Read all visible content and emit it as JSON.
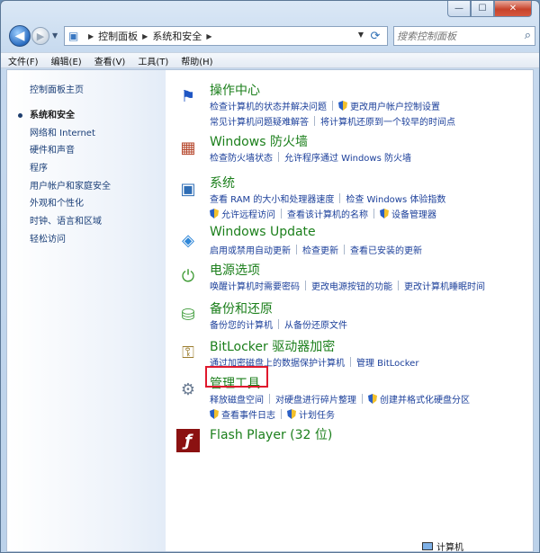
{
  "window": {
    "caption": {
      "minimize": "—",
      "maximize": "☐",
      "close": "✕"
    }
  },
  "address": {
    "crumbs": [
      "控制面板",
      "系统和安全"
    ],
    "search_placeholder": "搜索控制面板"
  },
  "menu": [
    "文件(F)",
    "编辑(E)",
    "查看(V)",
    "工具(T)",
    "帮助(H)"
  ],
  "sidebar": {
    "home": "控制面板主页",
    "items": [
      {
        "label": "系统和安全",
        "current": true
      },
      {
        "label": "网络和 Internet"
      },
      {
        "label": "硬件和声音"
      },
      {
        "label": "程序"
      },
      {
        "label": "用户帐户和家庭安全"
      },
      {
        "label": "外观和个性化"
      },
      {
        "label": "时钟、语言和区域"
      },
      {
        "label": "轻松访问"
      }
    ]
  },
  "categories": [
    {
      "title": "操作中心",
      "icon": "flag-icon",
      "lines": [
        [
          {
            "text": "检查计算机的状态并解决问题"
          },
          {
            "text": "更改用户帐户控制设置",
            "shield": true
          }
        ],
        [
          {
            "text": "常见计算机问题疑难解答"
          },
          {
            "text": "将计算机还原到一个较早的时间点"
          }
        ]
      ]
    },
    {
      "title": "Windows 防火墙",
      "icon": "firewall-icon",
      "lines": [
        [
          {
            "text": "检查防火墙状态"
          },
          {
            "text": "允许程序通过 Windows 防火墙"
          }
        ]
      ]
    },
    {
      "title": "系统",
      "icon": "system-icon",
      "lines": [
        [
          {
            "text": "查看 RAM 的大小和处理器速度"
          },
          {
            "text": "检查 Windows 体验指数"
          }
        ],
        [
          {
            "text": "允许远程访问",
            "shield": true
          },
          {
            "text": "查看该计算机的名称"
          },
          {
            "text": "设备管理器",
            "shield": true
          }
        ]
      ]
    },
    {
      "title": "Windows Update",
      "icon": "windows-update-icon",
      "lines": [
        [
          {
            "text": "启用或禁用自动更新"
          },
          {
            "text": "检查更新"
          },
          {
            "text": "查看已安装的更新"
          }
        ]
      ]
    },
    {
      "title": "电源选项",
      "icon": "power-options-icon",
      "lines": [
        [
          {
            "text": "唤醒计算机时需要密码"
          },
          {
            "text": "更改电源按钮的功能"
          },
          {
            "text": "更改计算机睡眠时间"
          }
        ]
      ]
    },
    {
      "title": "备份和还原",
      "icon": "backup-icon",
      "lines": [
        [
          {
            "text": "备份您的计算机"
          },
          {
            "text": "从备份还原文件"
          }
        ]
      ]
    },
    {
      "title": "BitLocker 驱动器加密",
      "icon": "bitlocker-icon",
      "lines": [
        [
          {
            "text": "通过加密磁盘上的数据保护计算机"
          },
          {
            "text": "管理 BitLocker"
          }
        ]
      ]
    },
    {
      "title": "管理工具",
      "icon": "admin-tools-icon",
      "lines": [
        [
          {
            "text": "释放磁盘空间"
          },
          {
            "text": "对硬盘进行碎片整理"
          },
          {
            "text": "创建并格式化硬盘分区",
            "shield": true
          }
        ],
        [
          {
            "text": "查看事件日志",
            "shield": true
          },
          {
            "text": "计划任务",
            "shield": true
          }
        ]
      ]
    },
    {
      "title": "Flash Player (32 位)",
      "icon": "flash-player-icon",
      "lines": []
    }
  ],
  "taskbar": {
    "label": "计算机"
  }
}
